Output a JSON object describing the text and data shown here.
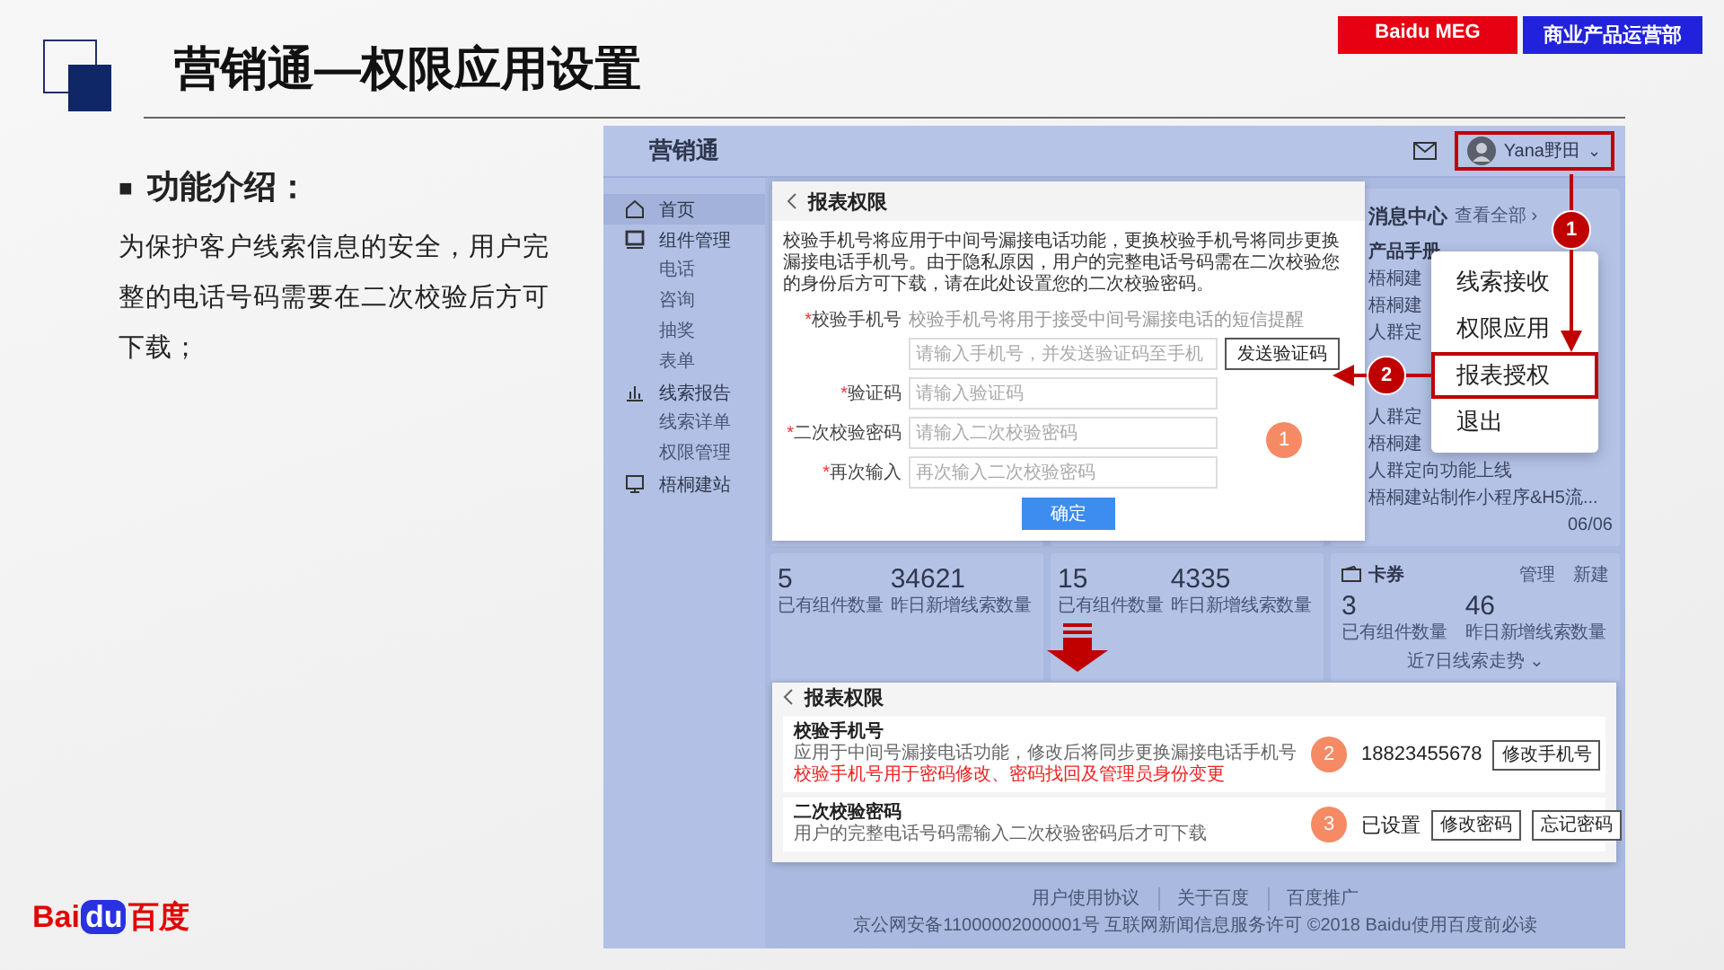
{
  "slide": {
    "title": "营销通—权限应用设置",
    "tags": [
      {
        "label": "Baidu MEG",
        "color": "#e60012"
      },
      {
        "label": "商业产品运营部",
        "color": "#2222dd"
      }
    ]
  },
  "intro": {
    "bullet": "■",
    "heading": "功能介绍：",
    "text": "为保护客户线索信息的安全，用户完整的电话号码需要在二次校验后方可下载；"
  },
  "app": {
    "name": "营销通",
    "user": {
      "name": "Yana野田",
      "caret": "⌄",
      "highlighted": true
    },
    "sidebar": [
      {
        "label": "首页",
        "kind": "home",
        "selected": true
      },
      {
        "label": "组件管理",
        "kind": "monitor",
        "selected": false,
        "children": [
          {
            "label": "电话",
            "selected": false
          },
          {
            "label": "咨询",
            "selected": false
          },
          {
            "label": "抽奖",
            "selected": false
          },
          {
            "label": "表单",
            "selected": false
          }
        ]
      },
      {
        "label": "线索报告",
        "kind": "chart",
        "selected": false,
        "children": [
          {
            "label": "线索详单",
            "selected": false
          },
          {
            "label": "权限管理",
            "selected": false
          }
        ]
      },
      {
        "label": "梧桐建站",
        "kind": "screen",
        "selected": false
      }
    ],
    "message_center": {
      "title": "消息中心",
      "more": "查看全部 ›",
      "section": "产品手册",
      "items": [
        {
          "text": "梧桐建"
        },
        {
          "text": "梧桐建"
        },
        {
          "text": "人群定"
        },
        {
          "text": "人群定"
        },
        {
          "text": "梧桐建"
        },
        {
          "text": "人群定向功能上线"
        },
        {
          "text": "梧桐建站制作小程序&H5流...",
          "date": "06/06"
        }
      ]
    },
    "stat_cards": [
      {
        "stats": [
          {
            "value": "5",
            "label": "已有组件数量"
          },
          {
            "value": "34621",
            "label": "昨日新增线索数量"
          }
        ]
      },
      {
        "stats": [
          {
            "value": "15",
            "label": "已有组件数量"
          },
          {
            "value": "4335",
            "label": "昨日新增线索数量"
          }
        ]
      }
    ],
    "coupon_card": {
      "title": "卡券",
      "actions": [
        "管理",
        "新建"
      ],
      "stats": [
        {
          "value": "3",
          "label": "已有组件数量"
        },
        {
          "value": "46",
          "label": "昨日新增线索数量"
        }
      ],
      "trend": "近7日线索走势",
      "trend_caret": "⌄"
    },
    "footer": {
      "links": [
        "用户使用协议",
        "关于百度",
        "百度推广"
      ],
      "legal": "京公网安备11000002000001号 互联网新闻信息服务许可 ©2018 Baidu使用百度前必读"
    },
    "menu": [
      {
        "label": "线索接收",
        "highlighted": false
      },
      {
        "label": "权限应用",
        "highlighted": false
      },
      {
        "label": "报表授权",
        "highlighted": true
      },
      {
        "label": "退出",
        "highlighted": false
      }
    ],
    "callouts": [
      "1",
      "2"
    ],
    "setup_dialog": {
      "title": "报表权限",
      "step": "1",
      "description": "校验手机号将应用于中间号漏接电话功能，更换校验手机号将同步更换漏接电话手机号。由于隐私原因，用户的完整电话号码需在二次校验您的身份后方可下载，请在此处设置您的二次校验密码。",
      "fields": [
        {
          "mark": "*",
          "label": "校验手机号",
          "hint": "校验手机号将用于接受中间号漏接电话的短信提醒",
          "placeholder": "请输入手机号，并发送验证码至手机",
          "button": "发送验证码"
        },
        {
          "mark": "*",
          "label": "验证码",
          "placeholder": "请输入验证码"
        },
        {
          "mark": "*",
          "label": "二次校验密码",
          "placeholder": "请输入二次校验密码"
        },
        {
          "mark": "*",
          "label": "再次输入",
          "placeholder": "再次输入二次校验密码"
        }
      ],
      "submit": "确定"
    },
    "result_dialog": {
      "title": "报表权限",
      "sections": [
        {
          "title": "校验手机号",
          "description": "应用于中间号漏接电话功能，修改后将同步更换漏接电话手机号",
          "note": "校验手机号用于密码修改、密码找回及管理员身份变更",
          "step": "2",
          "value": "18823455678",
          "buttons": [
            "修改手机号"
          ]
        },
        {
          "title": "二次校验密码",
          "description": "用户的完整电话号码需输入二次校验密码后才可下载",
          "step": "3",
          "value": "已设置",
          "buttons": [
            "修改密码",
            "忘记密码"
          ]
        }
      ]
    }
  },
  "logo": {
    "part_a": "Bai",
    "part_b": "du",
    "part_c": "百度"
  }
}
